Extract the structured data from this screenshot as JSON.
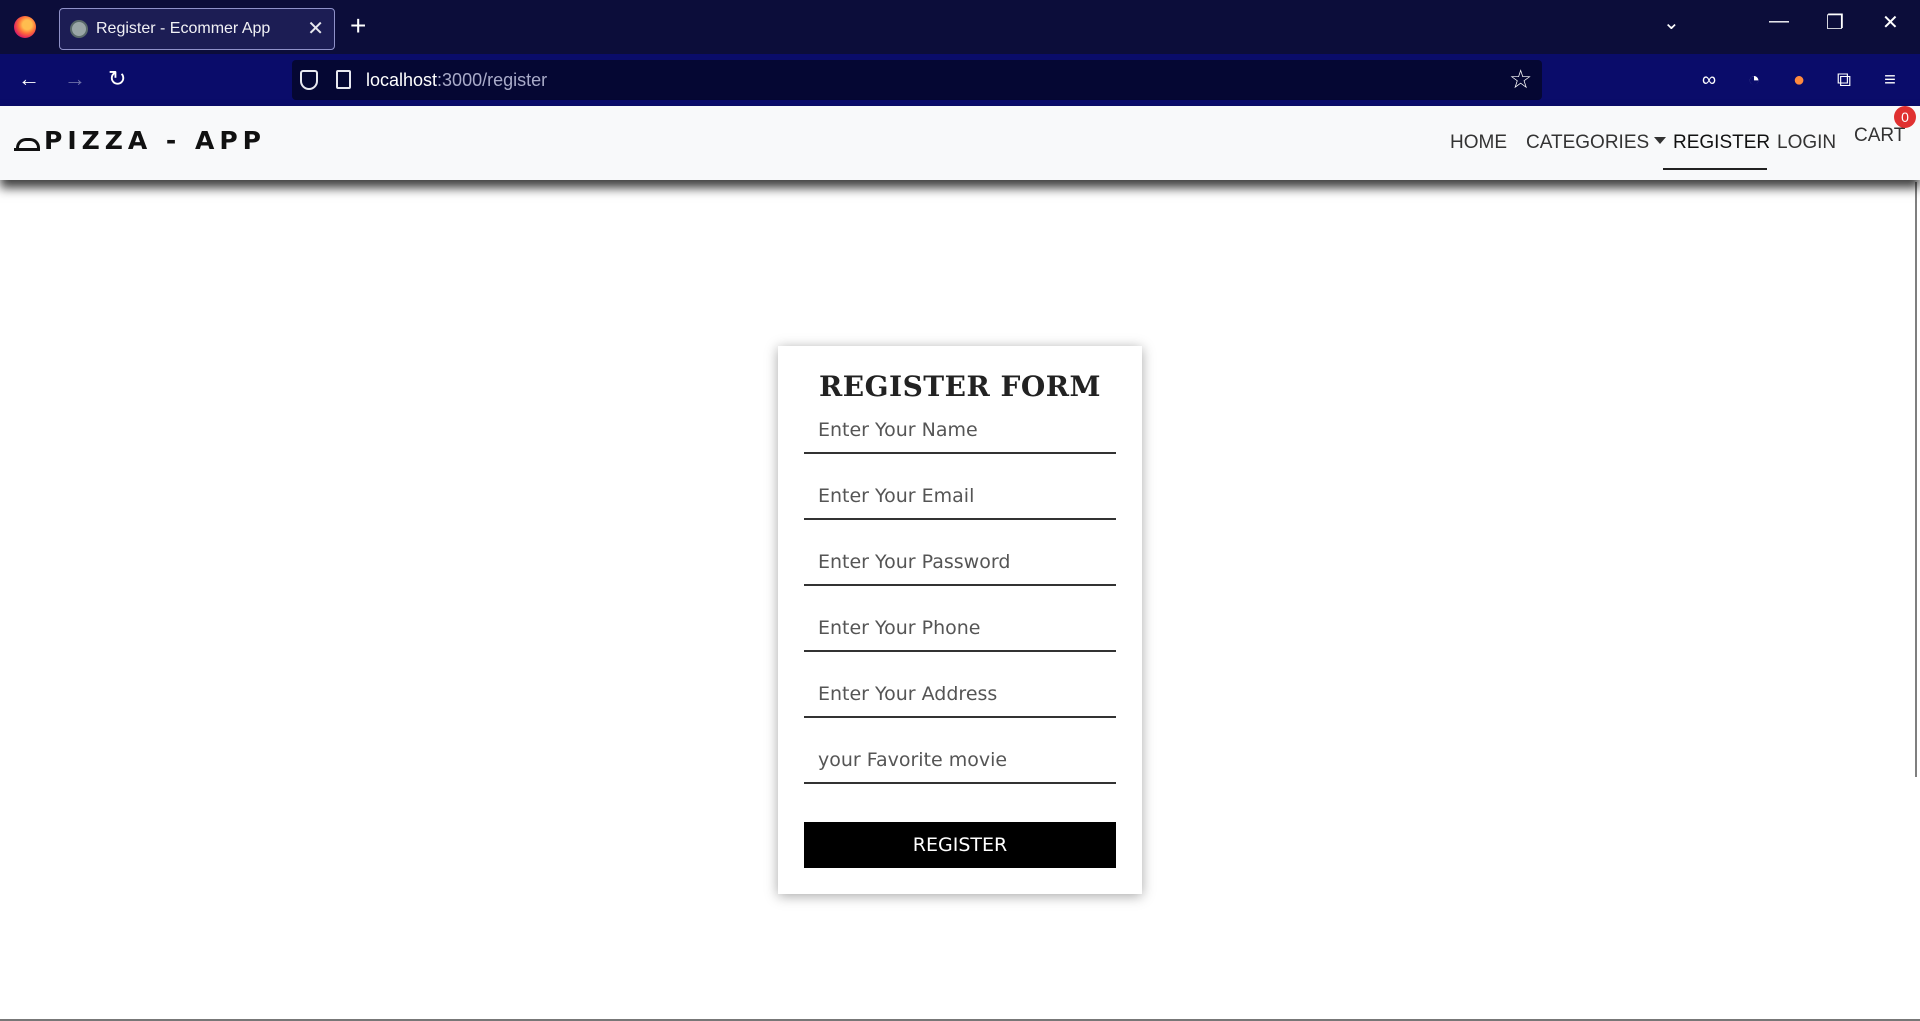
{
  "browser": {
    "tab_title": "Register - Ecommer App",
    "url_host": "localhost",
    "url_rest": ":3000/register",
    "icons": [
      "firefox-logo",
      "back-arrow",
      "forward-arrow",
      "reload",
      "shield",
      "page",
      "star",
      "incognito-mask",
      "cookie",
      "fox-extension",
      "puzzle",
      "hamburger-menu"
    ]
  },
  "header": {
    "brand": "PIZZA - APP",
    "menu": {
      "home": "HOME",
      "categories": "CATEGORIES",
      "register": "REGISTER",
      "login": "LOGIN",
      "cart": "CART",
      "cart_count": "0"
    }
  },
  "form": {
    "title": "REGISTER FORM",
    "name_placeholder": "Enter Your Name",
    "email_placeholder": "Enter Your Email",
    "password_placeholder": "Enter Your Password",
    "phone_placeholder": "Enter Your Phone",
    "address_placeholder": "Enter Your Address",
    "movie_placeholder": "your Favorite movie",
    "submit_label": "REGISTER"
  },
  "colors": {
    "tabbar_bg": "#0c0d3a",
    "navbar_bg": "#0a0c6a",
    "header_bg": "#f8f9fa",
    "badge": "#e03131",
    "button_bg": "#000000"
  }
}
